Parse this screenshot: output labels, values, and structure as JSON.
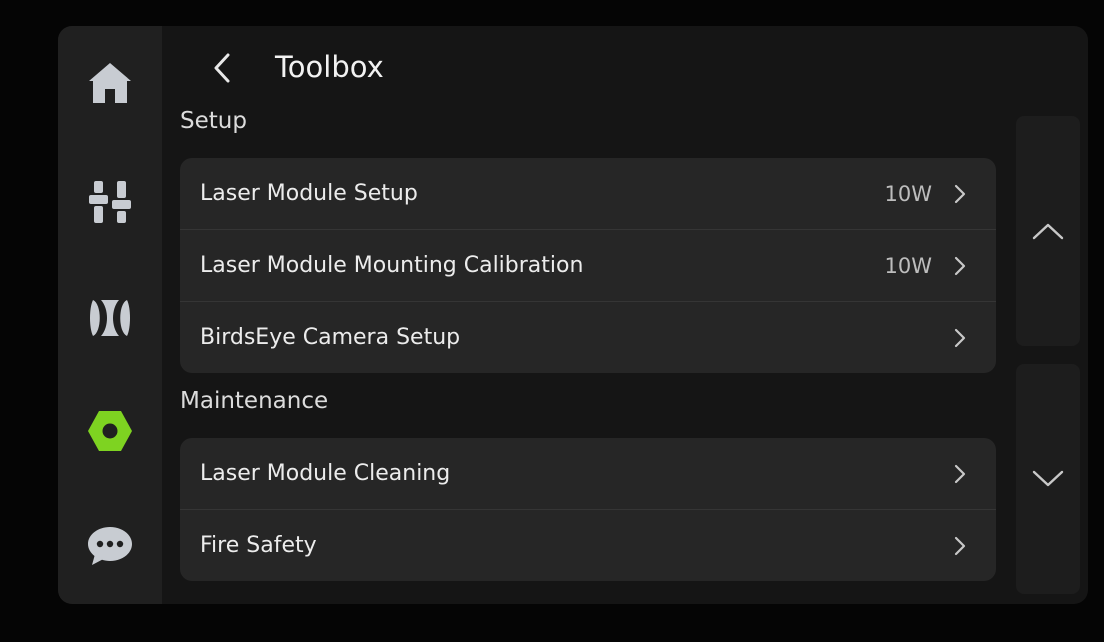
{
  "header": {
    "title": "Toolbox"
  },
  "sections": [
    {
      "label": "Setup",
      "items": [
        {
          "label": "Laser Module Setup",
          "value": "10W"
        },
        {
          "label": "Laser Module Mounting Calibration",
          "value": "10W"
        },
        {
          "label": "BirdsEye Camera Setup",
          "value": ""
        }
      ]
    },
    {
      "label": "Maintenance",
      "items": [
        {
          "label": "Laser Module Cleaning",
          "value": ""
        },
        {
          "label": "Fire Safety",
          "value": ""
        }
      ]
    }
  ],
  "sidebar": {
    "items": [
      {
        "icon": "home-icon",
        "active": false
      },
      {
        "icon": "sliders-icon",
        "active": false
      },
      {
        "icon": "material-icon",
        "active": false
      },
      {
        "icon": "toolbox-icon",
        "active": true
      },
      {
        "icon": "chat-icon",
        "active": false
      }
    ]
  },
  "colors": {
    "accent": "#7ed321",
    "icon": "#c8ccd2",
    "background": "#151515",
    "card": "#262626"
  }
}
